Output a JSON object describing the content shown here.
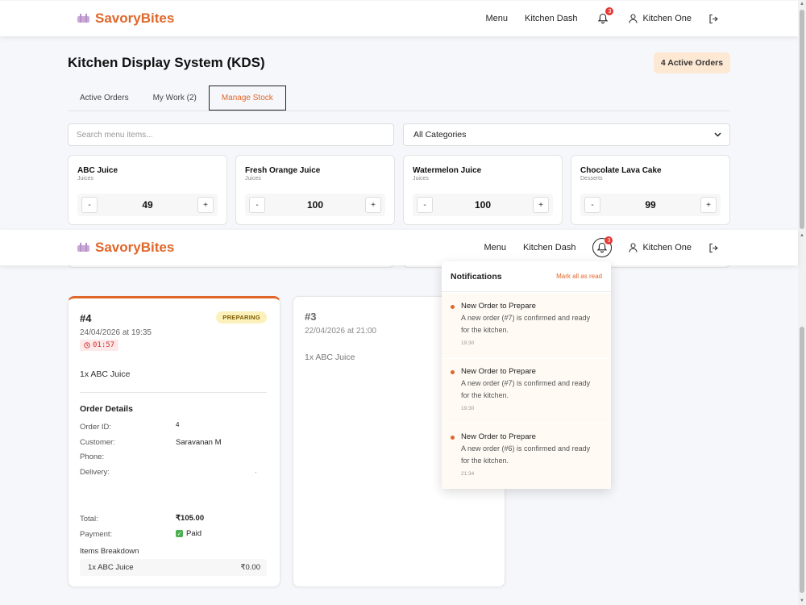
{
  "nav": {
    "brand": "SavoryBites",
    "menu": "Menu",
    "kitchen_dash": "Kitchen Dash",
    "notif_count": "3",
    "user": "Kitchen One"
  },
  "page": {
    "title": "Kitchen Display System (KDS)",
    "active_orders_badge": "4 Active Orders"
  },
  "tabs": [
    {
      "label": "Active Orders"
    },
    {
      "label": "My Work (2)"
    },
    {
      "label": "Manage Stock"
    }
  ],
  "filters": {
    "search_placeholder": "Search menu items...",
    "category": "All Categories"
  },
  "stock": [
    {
      "name": "ABC Juice",
      "category": "Juices",
      "qty": "49"
    },
    {
      "name": "Fresh Orange Juice",
      "category": "Juices",
      "qty": "100"
    },
    {
      "name": "Watermelon Juice",
      "category": "Juices",
      "qty": "100"
    },
    {
      "name": "Chocolate Lava Cake",
      "category": "Desserts",
      "qty": "99"
    }
  ],
  "stepper": {
    "minus": "-",
    "plus": "+"
  },
  "orders": [
    {
      "id": "#4",
      "date": "24/04/2026 at 19:35",
      "timer": "01:57",
      "status": "PREPARING",
      "item": "1x ABC Juice",
      "details_heading": "Order Details",
      "labels": {
        "order_id": "Order ID:",
        "customer": "Customer:",
        "phone": "Phone:",
        "delivery": "Delivery:",
        "total": "Total:",
        "payment": "Payment:"
      },
      "order_id": "4",
      "customer": "Saravanan M",
      "delivery": ".",
      "total": "₹105.00",
      "payment": "Paid",
      "breakdown_heading": "Items Breakdown",
      "breakdown_item": "1x ABC Juice",
      "breakdown_price": "₹0.00"
    },
    {
      "id": "#3",
      "date": "22/04/2026 at 21:00",
      "item": "1x ABC Juice"
    }
  ],
  "notifications": {
    "title": "Notifications",
    "mark_all": "Mark all as read",
    "items": [
      {
        "title": "New Order to Prepare",
        "body": "A new order (#7) is confirmed and ready for the kitchen.",
        "time": "19:30"
      },
      {
        "title": "New Order to Prepare",
        "body": "A new order (#7) is confirmed and ready for the kitchen.",
        "time": "19:30"
      },
      {
        "title": "New Order to Prepare",
        "body": "A new order (#6) is confirmed and ready for the kitchen.",
        "time": "21:34"
      }
    ]
  },
  "colors": {
    "accent": "#e0672a",
    "badge_bg": "#fde8d3",
    "status_bg": "#fdf1bb",
    "timer_red": "#d32f2f"
  }
}
